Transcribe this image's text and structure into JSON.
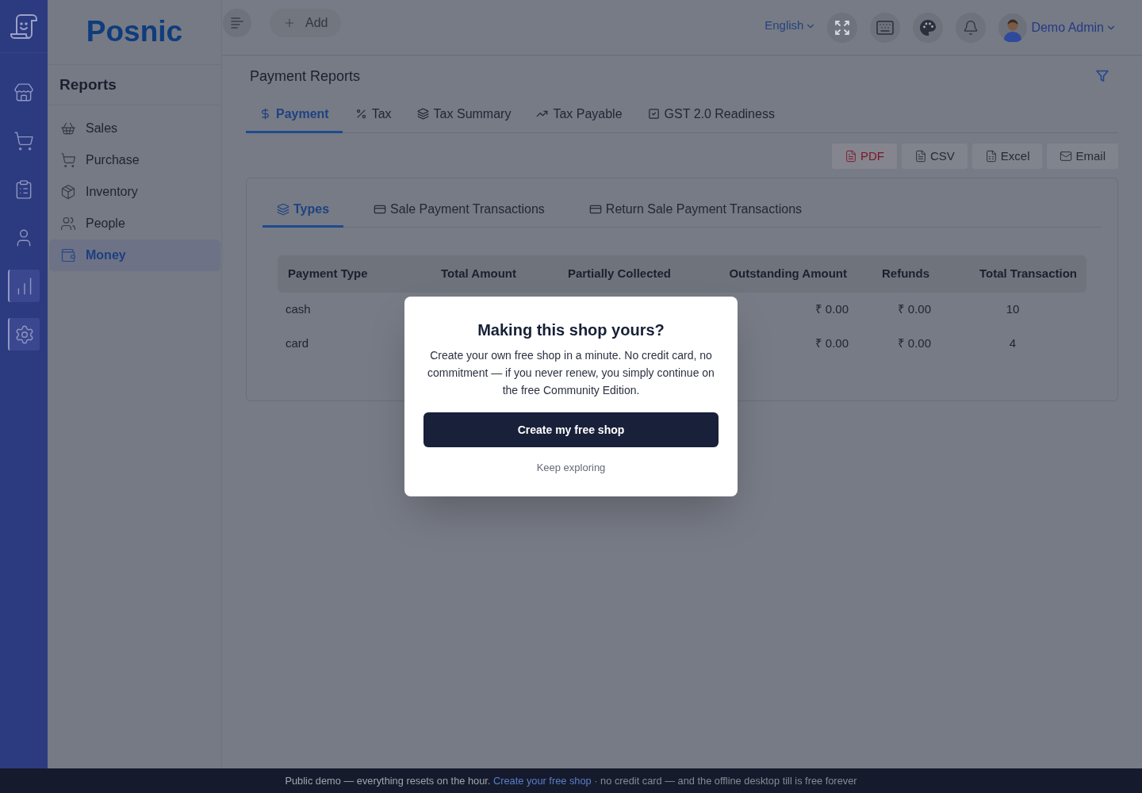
{
  "rail": {
    "items": [
      {
        "selected": false
      },
      {
        "selected": false
      },
      {
        "selected": false
      },
      {
        "selected": false
      },
      {
        "selected": true
      },
      {
        "selected": true
      }
    ]
  },
  "sidebar": {
    "logo": "Posnic",
    "heading": "Reports",
    "items": [
      {
        "label": "Sales",
        "selected": false
      },
      {
        "label": "Purchase",
        "selected": false
      },
      {
        "label": "Inventory",
        "selected": false
      },
      {
        "label": "People",
        "selected": false
      },
      {
        "label": "Money",
        "selected": true
      }
    ]
  },
  "top_bar": {
    "add_button": "Add",
    "language": "English",
    "user_name": "Demo Admin"
  },
  "page": {
    "title": "Payment Reports",
    "tabs": [
      {
        "label": "Payment",
        "selected": true
      },
      {
        "label": "Tax",
        "selected": false
      },
      {
        "label": "Tax Summary",
        "selected": false
      },
      {
        "label": "Tax Payable",
        "selected": false
      },
      {
        "label": "GST 2.0 Readiness",
        "selected": false
      }
    ],
    "export_buttons": [
      {
        "kind": "pdf",
        "label": "PDF"
      },
      {
        "kind": "csv",
        "label": "CSV"
      },
      {
        "kind": "excel",
        "label": "Excel"
      },
      {
        "kind": "email",
        "label": "Email"
      }
    ]
  },
  "report": {
    "tabs": [
      {
        "label": "Types",
        "selected": true
      },
      {
        "label": "Sale Payment Transactions",
        "selected": false
      },
      {
        "label": "Return Sale Payment Transactions",
        "selected": false
      }
    ],
    "table": {
      "columns": [
        "Payment Type",
        "Total Amount",
        "Partially Collected",
        "Outstanding Amount",
        "Refunds",
        "Total Transaction"
      ],
      "rows": [
        {
          "payment_type": "cash",
          "outstanding_amount": "₹ 0.00",
          "refunds": "₹ 0.00",
          "total_transaction": "10"
        },
        {
          "payment_type": "card",
          "outstanding_amount": "₹ 0.00",
          "refunds": "₹ 0.00",
          "total_transaction": "4"
        }
      ]
    }
  },
  "modal": {
    "title": "Making this shop yours?",
    "body": "Create your own free shop in a minute. No credit card, no commitment — if you never renew, you simply continue on the free Community Edition.",
    "primary_button": "Create my free shop",
    "secondary_link": "Keep exploring"
  },
  "footer": {
    "text_before": "Public demo — everything resets on the hour.",
    "link": "Create your free shop",
    "text_after": "· no credit card — and the offline desktop till is free forever"
  }
}
